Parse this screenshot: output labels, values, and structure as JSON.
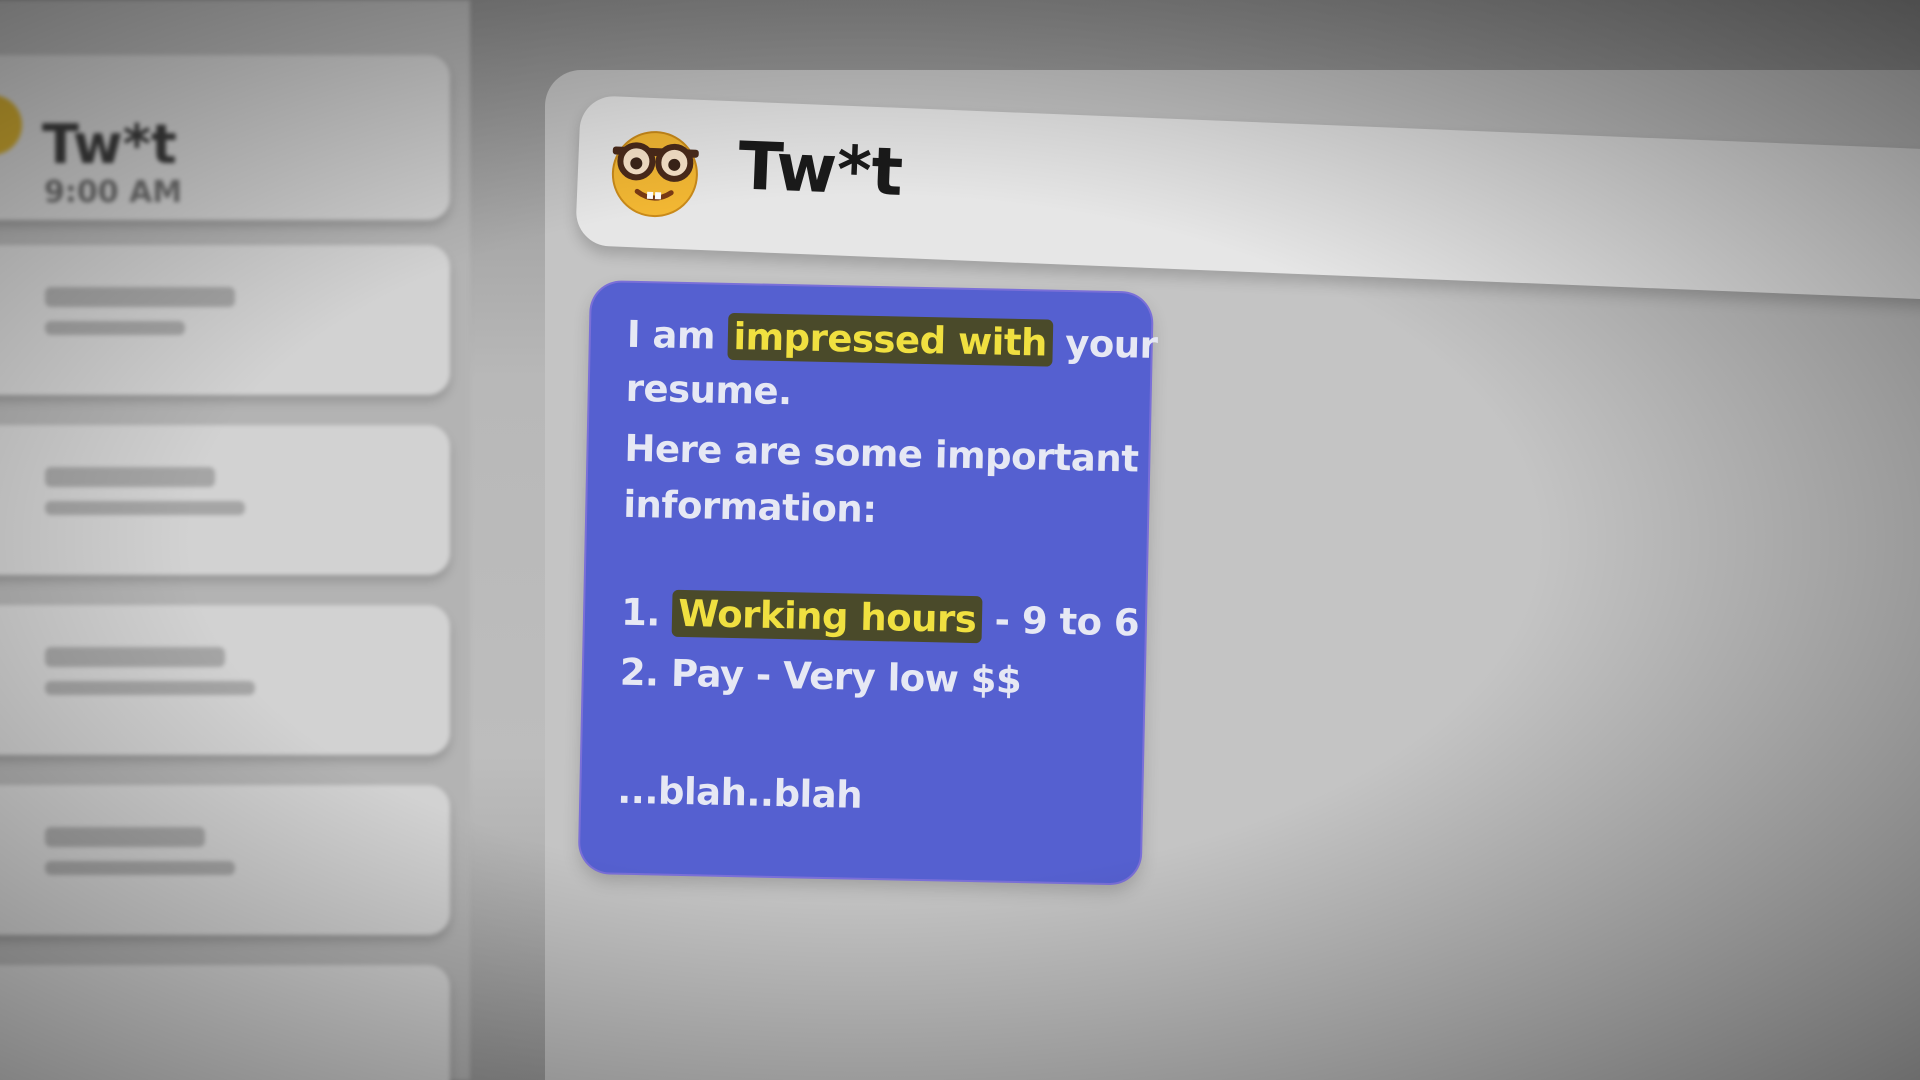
{
  "sidebar": {
    "first_chat": {
      "name": "Tw*t",
      "time": "9:00 AM"
    }
  },
  "header": {
    "contact_name": "Tw*t",
    "avatar_icon": "nerd-face-icon"
  },
  "message": {
    "line1_pre": "I am ",
    "line1_highlight": "impressed with",
    "line1_post": " your",
    "line2": "resume.",
    "line3": "Here are some important",
    "line4": "information:",
    "line5_number": "1. ",
    "line5_highlight": "Working hours",
    "line5_post": " - 9 to 6",
    "line6": "2. Pay - Very low $$",
    "line7": "...blah..blah"
  },
  "colors": {
    "bubble": "#5560d0",
    "highlight_text": "#f0e040",
    "header_bg": "#e6e6e6"
  }
}
